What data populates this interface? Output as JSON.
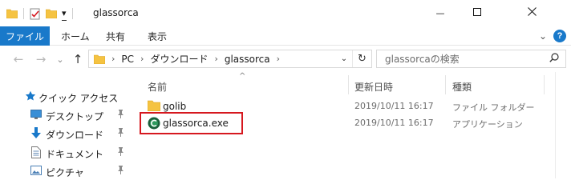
{
  "window": {
    "title": "glassorca",
    "qat_dropdown_glyph": "▾",
    "controls": {
      "minimize": "—",
      "maximize": "☐",
      "close": "✕"
    }
  },
  "ribbon": {
    "file_tab": "ファイル",
    "tabs": [
      "ホーム",
      "共有",
      "表示"
    ],
    "collapse_glyph": "⌄",
    "help_glyph": "?"
  },
  "navigation": {
    "back_glyph": "←",
    "forward_glyph": "→",
    "recent_glyph": "⌄",
    "up_glyph": "↑"
  },
  "address": {
    "crumbs": [
      "PC",
      "ダウンロード",
      "glassorca"
    ],
    "separator": "›",
    "dropdown_glyph": "⌄",
    "refresh_glyph": "↻"
  },
  "search": {
    "placeholder": "glassorcaの検索"
  },
  "navpane": {
    "items": [
      {
        "label": "クイック アクセス",
        "icon": "star-icon"
      },
      {
        "label": "デスクトップ",
        "icon": "desktop-icon",
        "pinned": true
      },
      {
        "label": "ダウンロード",
        "icon": "download-icon",
        "pinned": true
      },
      {
        "label": "ドキュメント",
        "icon": "document-icon",
        "pinned": true
      },
      {
        "label": "ピクチャ",
        "icon": "picture-icon",
        "pinned": true
      }
    ],
    "pin_glyph": "📌"
  },
  "filelist": {
    "sort_glyph": "^",
    "columns": {
      "name": "名前",
      "date": "更新日時",
      "type": "種類"
    },
    "rows": [
      {
        "name": "golib",
        "date": "2019/10/11 16:17",
        "type": "ファイル フォルダー",
        "icon": "folder-icon"
      },
      {
        "name": "glassorca.exe",
        "date": "2019/10/11 16:17",
        "type": "アプリケーション",
        "icon": "app-icon",
        "highlighted": true
      }
    ]
  },
  "colors": {
    "accent": "#1979ca",
    "folder": "#f5c342",
    "highlight_border": "#d6181f"
  }
}
